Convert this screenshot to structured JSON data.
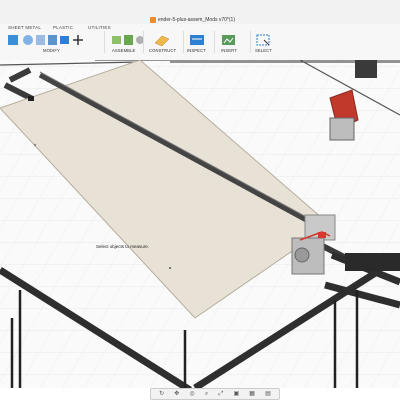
{
  "window": {
    "document_title": "ender-5-plus-assem_Mods v70*(1)"
  },
  "tabs": [
    "SHEET METAL",
    "PLASTIC",
    "UTILITIES"
  ],
  "toolbar": {
    "groups": [
      "MODIFY",
      "ASSEMBLE",
      "CONSTRUCT",
      "INSPECT",
      "INSERT",
      "SELECT"
    ]
  },
  "viewport": {
    "status_message": "Select objects to measure."
  },
  "navbar": {
    "tools": [
      "orbit",
      "pan",
      "look-at",
      "zoom",
      "fit",
      "display-settings",
      "grid",
      "viewports"
    ]
  },
  "colors": {
    "bed": "#e8e2d6",
    "frame": "#5a5a5a",
    "accent_red": "#d23a2e",
    "ribbon_blue": "#2d7fd1"
  }
}
